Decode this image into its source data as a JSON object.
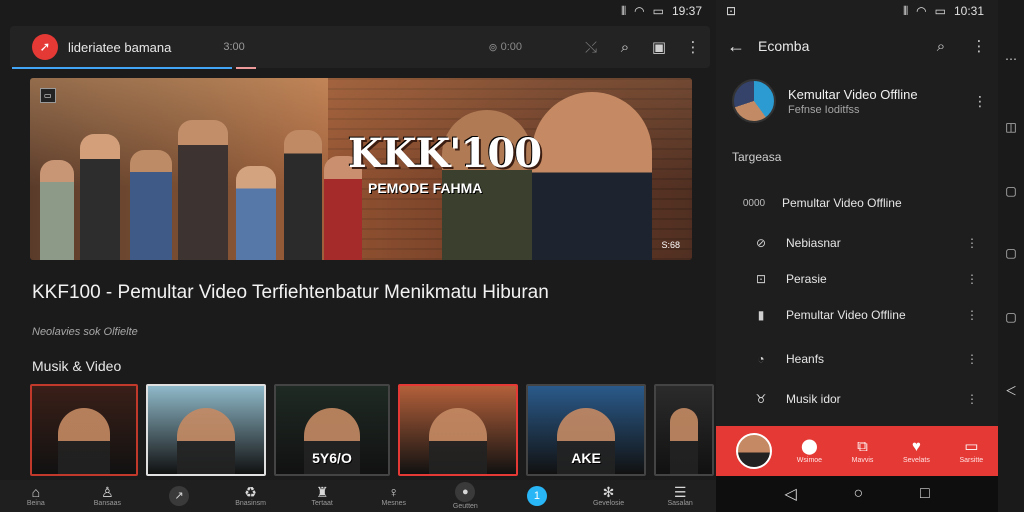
{
  "left_status": {
    "time": "19:37"
  },
  "right_status": {
    "time": "10:31"
  },
  "topbar": {
    "app_title": "lideriatee bamana",
    "app_meta": "3:00",
    "search_meta": "0:00"
  },
  "hero": {
    "badge": "",
    "title": "KKK'100",
    "subtitle": "PEMODE FAHMA",
    "corner": "S:68"
  },
  "video": {
    "title": "KKF100 - Pemultar Video Terfiehtenbatur Menikmatu Hiburan",
    "subtitle": "Neolavies sok Olfielte"
  },
  "section_label": "Musik & Video",
  "thumbnails": [
    {
      "label": "",
      "title": "",
      "bg": "#3a1f18",
      "border": "#c0392b",
      "width": 108
    },
    {
      "label": "",
      "title": "",
      "bg": "#8fb9c9",
      "border": "#e0e0e0",
      "width": 120
    },
    {
      "label": "",
      "title": "5Y6/O",
      "bg": "#1f2a24",
      "border": "#444",
      "width": 116
    },
    {
      "label": "",
      "title": "",
      "bg": "#b3603a",
      "border": "#e53935",
      "width": 120
    },
    {
      "label": "",
      "title": "AKE",
      "bg": "#2a5a8a",
      "border": "#444",
      "width": 120
    },
    {
      "label": "",
      "title": "",
      "bg": "#2b2b2b",
      "border": "#444",
      "width": 60
    }
  ],
  "bottom_nav": [
    {
      "icon": "⌂",
      "label": "Beina",
      "style": ""
    },
    {
      "icon": "♙",
      "label": "Bansaas",
      "style": ""
    },
    {
      "icon": "↗",
      "label": "",
      "style": "circle"
    },
    {
      "icon": "♻",
      "label": "Bnasinsm",
      "style": ""
    },
    {
      "icon": "♜",
      "label": "Tertaat",
      "style": ""
    },
    {
      "icon": "♀",
      "label": "Mesnes",
      "style": ""
    },
    {
      "icon": "●",
      "label": "Geutten",
      "style": "circle"
    },
    {
      "icon": "1",
      "label": "",
      "style": "circle accent"
    },
    {
      "icon": "✻",
      "label": "Gevelosie",
      "style": ""
    },
    {
      "icon": "☰",
      "label": "Sasalan",
      "style": ""
    }
  ],
  "panel": {
    "title": "Ecomba",
    "channel_name": "Kemultar Video Offline",
    "channel_sub": "Fefnse Ioditfss",
    "section": "Targeasa",
    "items": [
      {
        "icon": "0000",
        "label": "Pemultar Video Offline",
        "wide": true,
        "kebab": false
      },
      {
        "icon": "⊘",
        "label": "Nebiasnar",
        "wide": false,
        "kebab": true
      },
      {
        "icon": "⊡",
        "label": "Perasie",
        "wide": false,
        "kebab": true
      },
      {
        "icon": "▮",
        "label": "Pemultar Video Offline",
        "wide": false,
        "kebab": true
      },
      {
        "icon": "◔",
        "label": "Heanfs",
        "wide": false,
        "kebab": true
      },
      {
        "icon": "♉",
        "label": "Musik idor",
        "wide": false,
        "kebab": true
      }
    ],
    "footer": [
      {
        "icon": "⬤",
        "label": "Wsimoe"
      },
      {
        "icon": "⧉",
        "label": "Mavvis"
      },
      {
        "icon": "♥",
        "label": "Sevelats"
      },
      {
        "icon": "▭",
        "label": "Sarsitte"
      }
    ]
  },
  "colors": {
    "accent_red": "#e53935",
    "accent_blue": "#29b6f6"
  }
}
